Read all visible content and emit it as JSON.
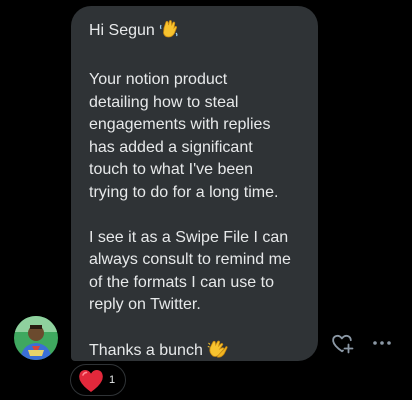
{
  "message": {
    "greeting": "Hi Segun",
    "greeting_emoji": "waving-hand",
    "paragraph_1": [
      "Your notion product",
      "detailing how to steal",
      "engagements with replies",
      "has added a significant",
      "touch to what I've been",
      "trying to do for a long time."
    ],
    "paragraph_2": [
      "I see it as a Swipe File I can",
      "always consult to remind me",
      "of the formats I can use to",
      "reply on Twitter."
    ],
    "closing": "Thanks a bunch",
    "closing_emoji": "clapping-hands"
  },
  "reaction": {
    "emoji": "red-heart",
    "count": "1"
  },
  "icons": {
    "add_reaction": "heart-plus-icon",
    "more": "more-icon"
  },
  "colors": {
    "background": "#000000",
    "bubble": "#2f3336",
    "text": "#e7e9ea",
    "heart": "#f91880"
  }
}
